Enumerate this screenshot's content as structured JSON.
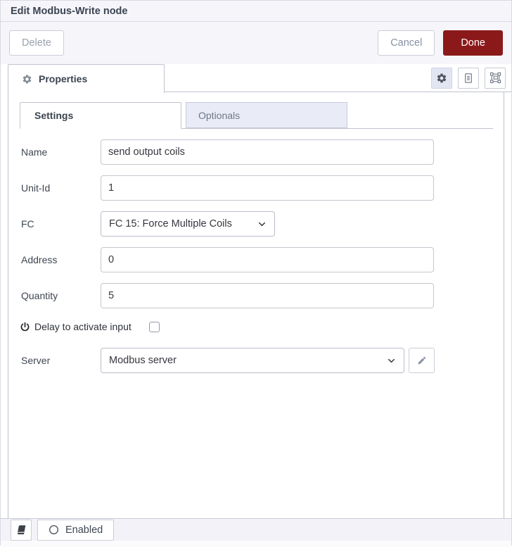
{
  "dialog": {
    "title": "Edit Modbus-Write node"
  },
  "header": {
    "delete_label": "Delete",
    "cancel_label": "Cancel",
    "done_label": "Done"
  },
  "tray": {
    "properties_tab_label": "Properties",
    "toolbar_icons": [
      "gear-icon",
      "document-icon",
      "selection-frame-icon"
    ],
    "active_toolbar_icon": "gear-icon"
  },
  "subtabs": {
    "settings_label": "Settings",
    "optionals_label": "Optionals",
    "active": "Settings"
  },
  "form": {
    "name": {
      "label": "Name",
      "value": "send output coils"
    },
    "unit_id": {
      "label": "Unit-Id",
      "value": "1"
    },
    "fc": {
      "label": "FC",
      "value": "FC 15: Force Multiple Coils"
    },
    "address": {
      "label": "Address",
      "value": "0"
    },
    "quantity": {
      "label": "Quantity",
      "value": "5"
    },
    "delay": {
      "label": "Delay to activate input",
      "icon": "power-icon",
      "checked": false
    },
    "server": {
      "label": "Server",
      "value": "Modbus server",
      "edit_icon": "pencil-icon"
    }
  },
  "footer": {
    "book_icon": "book-icon",
    "enabled_icon": "circle-icon",
    "enabled_label": "Enabled"
  },
  "colors": {
    "done_bg": "#8C1919",
    "inactive_tab_bg": "#e9ecf7",
    "active_icon_button_bg": "#e2e5f2",
    "border": "#bfc3cd",
    "header_bg": "#f5f5fa"
  }
}
